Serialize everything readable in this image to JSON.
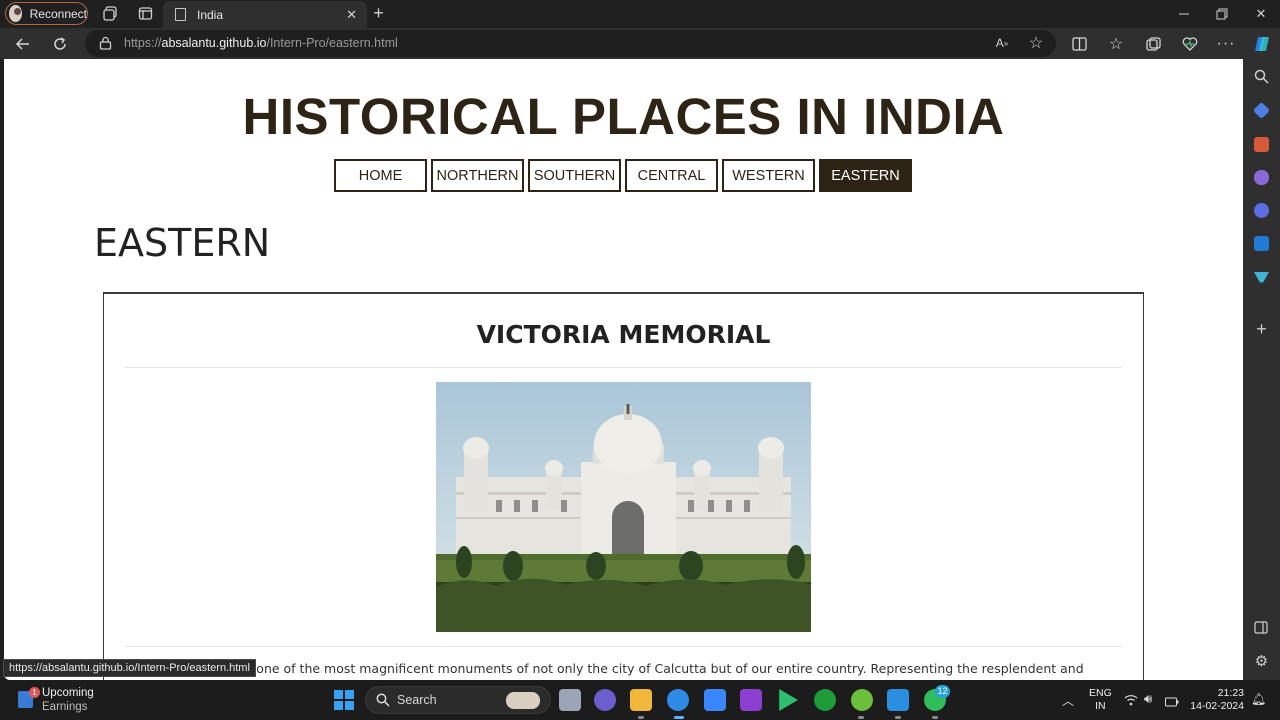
{
  "browser": {
    "profile_button": "Reconnect",
    "tab_title": "India",
    "url_prefix": "https://",
    "url_domain": "absalantu.github.io",
    "url_path": "/Intern-Pro/eastern.html",
    "status_url": "https://absalantu.github.io/Intern-Pro/eastern.html"
  },
  "page": {
    "site_title": "HISTORICAL PLACES IN INDIA",
    "nav": [
      {
        "label": "HOME"
      },
      {
        "label": "NORTHERN"
      },
      {
        "label": "SOUTHERN"
      },
      {
        "label": "CENTRAL"
      },
      {
        "label": "WESTERN"
      },
      {
        "label": "EASTERN"
      }
    ],
    "active_nav": "EASTERN",
    "region_heading": "EASTERN",
    "card": {
      "title": "VICTORIA MEMORIAL",
      "text_visible": "orial Hall is one of the most magnificent monuments of not only the city of Calcutta but of our entire country. Representing the resplendent and"
    }
  },
  "taskbar": {
    "widget_title": "Upcoming",
    "widget_subtitle": "Earnings",
    "widget_badge": "1",
    "search_label": "Search",
    "whatsapp_badge": "12",
    "lang_line1": "ENG",
    "lang_line2": "IN",
    "time": "21:23",
    "date": "14-02-2024"
  },
  "colors": {
    "brand_dark": "#2e2416",
    "browser_chrome": "#202020",
    "accent_blue": "#3aa0f3"
  }
}
